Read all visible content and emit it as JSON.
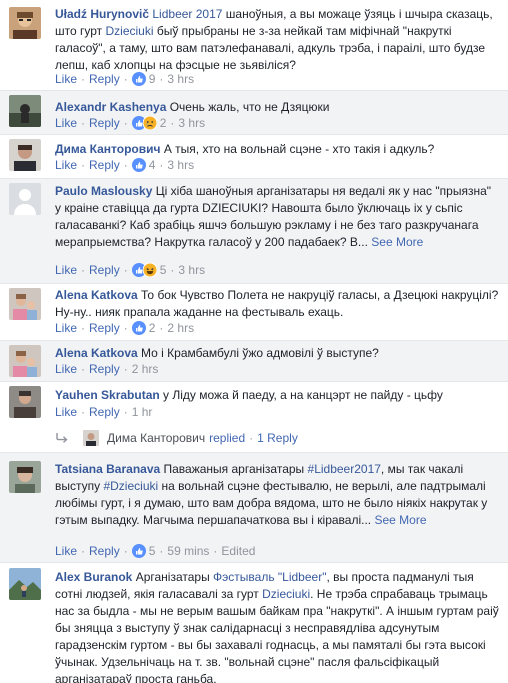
{
  "ui": {
    "like_label": "Like",
    "reply_label": "Reply",
    "dot": "·",
    "see_more_label": "See More",
    "edited_label": "Edited"
  },
  "colors": {
    "link": "#4267b2",
    "author": "#365899",
    "muted": "#90949c",
    "shaded_bg": "#f2f3f5",
    "like_blue": "#5890ff",
    "haha_yellow": "#f7b125"
  },
  "comments": [
    {
      "author": "Uładź Hurynovič",
      "text_parts": [
        {
          "t": " "
        },
        {
          "t": "Lidbeer 2017",
          "hl": true
        },
        {
          "t": " шаноўныя, а вы можаце ўзяць і шчыра сказаць, што гурт "
        },
        {
          "t": "Dzieciuki",
          "hl": true
        },
        {
          "t": " быў прыбраны не з-за нейкай там міфічнай \"накруткі галасоў\", а таму, што вам патэлефанавалі, адкуль трэба, і параілі, што будзе лепш, каб хлопцы на фэсцые не зьявіліся?"
        }
      ],
      "reactions_icon": "like-icon",
      "reactions_count": "9",
      "time": "3 hrs"
    },
    {
      "author": "Alexandr Kashenya",
      "text_parts": [
        {
          "t": " Очень жаль, что не Дзяцюки"
        }
      ],
      "reactions_icon": "like-sad-icons",
      "reactions_count": "2",
      "time": "3 hrs"
    },
    {
      "author": "Дима Канторович",
      "text_parts": [
        {
          "t": " А тыя, хто на вольнай сцэне - хто такія і адкуль?"
        }
      ],
      "reactions_icon": "like-icon",
      "reactions_count": "4",
      "time": "3 hrs"
    },
    {
      "author": "Paulo Maslousky",
      "text_parts": [
        {
          "t": " Ці хіба шаноўныя арганізатары ня ведалі як у нас \"прыязна\" у краіне ставіцца да гурта DZIECIUKI? Навошта было ўключаць іх у сьпіс галасаванкі? Каб зрабіць яшчэ большую рэкламу і не без таго разкручанага мерапрыемства? Накрутка галасоў у 200 падабаек? В..."
        }
      ],
      "see_more": true,
      "reactions_icon": "like-haha-icons",
      "reactions_count": "5",
      "time": "3 hrs"
    },
    {
      "author": "Alena Katkova",
      "text_parts": [
        {
          "t": " То бок Чувство Полета не накруціў галасы, а Дзецюкі накруцілі? Ну-ну.. нияк прапала жаданне на фестываль ехаць."
        }
      ],
      "reactions_icon": "like-icon",
      "reactions_count": "2",
      "time": "2 hrs"
    },
    {
      "author": "Alena Katkova",
      "text_parts": [
        {
          "t": " Мо і Крамбамбулі ўжо адмовілі ў выступе?"
        }
      ],
      "reactions_icon": "",
      "reactions_count": "",
      "time": "2 hrs"
    },
    {
      "author": "Yauhen Skrabutan",
      "text_parts": [
        {
          "t": " у Ліду можа й паеду, а на канцэрт не пайду - цьфу"
        }
      ],
      "reactions_icon": "",
      "reactions_count": "",
      "time": "1 hr",
      "replies": {
        "name": "Дима Канторович",
        "action": "replied",
        "count": "1 Reply"
      }
    },
    {
      "author": "Tatsiana Baranava",
      "text_parts": [
        {
          "t": " Паважаныя арганізатары "
        },
        {
          "t": "#Lidbeer2017",
          "hl": true
        },
        {
          "t": ", мы так чакалі выступу "
        },
        {
          "t": "#Dzieciuki",
          "hl": true
        },
        {
          "t": " на вольнай сцэне фестывалю, не верылі, але падтрымалі любімы гурт, і я думаю, што вам добра вядома, што не было ніякіх накрутак у гэтым выпадку. Магчыма першапачатковa вы і кіравалі..."
        }
      ],
      "see_more": true,
      "reactions_icon": "like-icon",
      "reactions_count": "5",
      "time": "59 mins",
      "edited": true
    },
    {
      "author": "Alex Buranok",
      "text_parts": [
        {
          "t": " Арганізатары "
        },
        {
          "t": "Фэстываль \"Lidbeer\"",
          "hl": true
        },
        {
          "t": ", вы проста падманулі тыя сотні людзей, якія галасавалі за гурт "
        },
        {
          "t": "Dzieciuki",
          "hl": true
        },
        {
          "t": ". Не трэба спрабаваць трымаць нас за быдла - мы не верым вашым байкам пра \"накруткі\". А іншым гуртам раіў бы зняцца з выступу ў знак салідарнасці з несправядліва адсунутым гарадзенскім гуртом - вы бы захавалі годнасць, а мы памяталі бы гэта высокі ўчынак. Удзельнічаць на т. зв. \"вольнай сцэне\" пасля фальсіфікацый арганізатараў проста ганьба."
        }
      ],
      "reactions_icon": "",
      "reactions_count": "",
      "time": ""
    }
  ]
}
